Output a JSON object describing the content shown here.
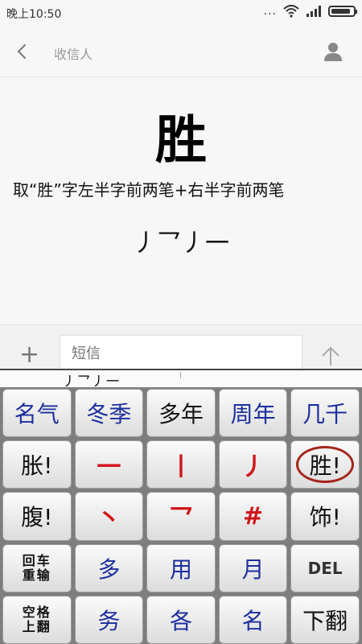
{
  "status_bar": {
    "time": "晚上10:50",
    "dots": "...",
    "battery_level": 0.9
  },
  "header": {
    "title": "收信人"
  },
  "message": {
    "big_char": "胜",
    "hint": "取“胜”字左半字前两笔+右半字前两笔",
    "strokes": "丿乛丿一"
  },
  "compose": {
    "placeholder": "短信",
    "plus": "+"
  },
  "keyboard": {
    "composition": "丿乛丿一",
    "keys": [
      {
        "label": "名气",
        "style": "blue"
      },
      {
        "label": "冬季",
        "style": "blue"
      },
      {
        "label": "多年",
        "style": ""
      },
      {
        "label": "周年",
        "style": "blue"
      },
      {
        "label": "几千",
        "style": "blue"
      },
      {
        "label": "胀!",
        "style": ""
      },
      {
        "label": "一",
        "style": "stroke"
      },
      {
        "label": "丨",
        "style": "stroke"
      },
      {
        "label": "丿",
        "style": "stroke"
      },
      {
        "label": "胜!",
        "style": "",
        "circled": true
      },
      {
        "label": "腹!",
        "style": ""
      },
      {
        "label": "丶",
        "style": "stroke"
      },
      {
        "label": "乛",
        "style": "stroke"
      },
      {
        "label": "#",
        "style": "stroke"
      },
      {
        "label": "饰!",
        "style": ""
      },
      {
        "label": "回车\n重输",
        "style": "small"
      },
      {
        "label": "多",
        "style": "blue"
      },
      {
        "label": "用",
        "style": "blue"
      },
      {
        "label": "月",
        "style": "blue"
      },
      {
        "label": "DEL",
        "style": "del"
      },
      {
        "label": "空格\n上翻",
        "style": "small"
      },
      {
        "label": "务",
        "style": "blue"
      },
      {
        "label": "各",
        "style": "blue"
      },
      {
        "label": "名",
        "style": "blue"
      },
      {
        "label": "下翻",
        "style": ""
      }
    ]
  }
}
